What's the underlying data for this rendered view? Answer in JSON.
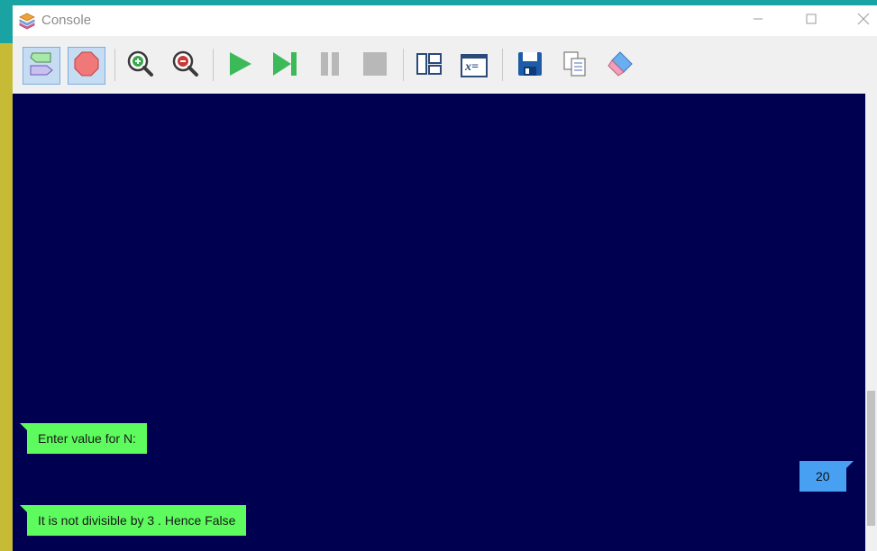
{
  "window": {
    "title": "Console",
    "app_icon": "stack-layers-icon"
  },
  "window_controls": [
    "minimize-icon",
    "maximize-icon",
    "close-icon"
  ],
  "toolbar": {
    "buttons": [
      {
        "icon": "flowchart-mode-icon",
        "active": true
      },
      {
        "icon": "stop-sign-icon",
        "active": true
      },
      {
        "icon": "zoom-in-icon"
      },
      {
        "icon": "zoom-out-icon"
      },
      {
        "icon": "run-icon"
      },
      {
        "icon": "step-icon"
      },
      {
        "icon": "pause-icon"
      },
      {
        "icon": "stop-icon"
      },
      {
        "icon": "layout-icon"
      },
      {
        "icon": "variables-icon",
        "label": "x="
      },
      {
        "icon": "save-icon"
      },
      {
        "icon": "copy-icon"
      },
      {
        "icon": "eraser-icon"
      }
    ]
  },
  "console": {
    "background": "#000050",
    "messages": [
      {
        "type": "output",
        "text": "Enter value for N:"
      },
      {
        "type": "input",
        "text": "20"
      },
      {
        "type": "output",
        "text": "It is not divisible by 3 . Hence False"
      }
    ]
  },
  "colors": {
    "output_bubble": "#5dfb5d",
    "input_bubble": "#48a0f3",
    "active_button": "#c5dcf3"
  }
}
